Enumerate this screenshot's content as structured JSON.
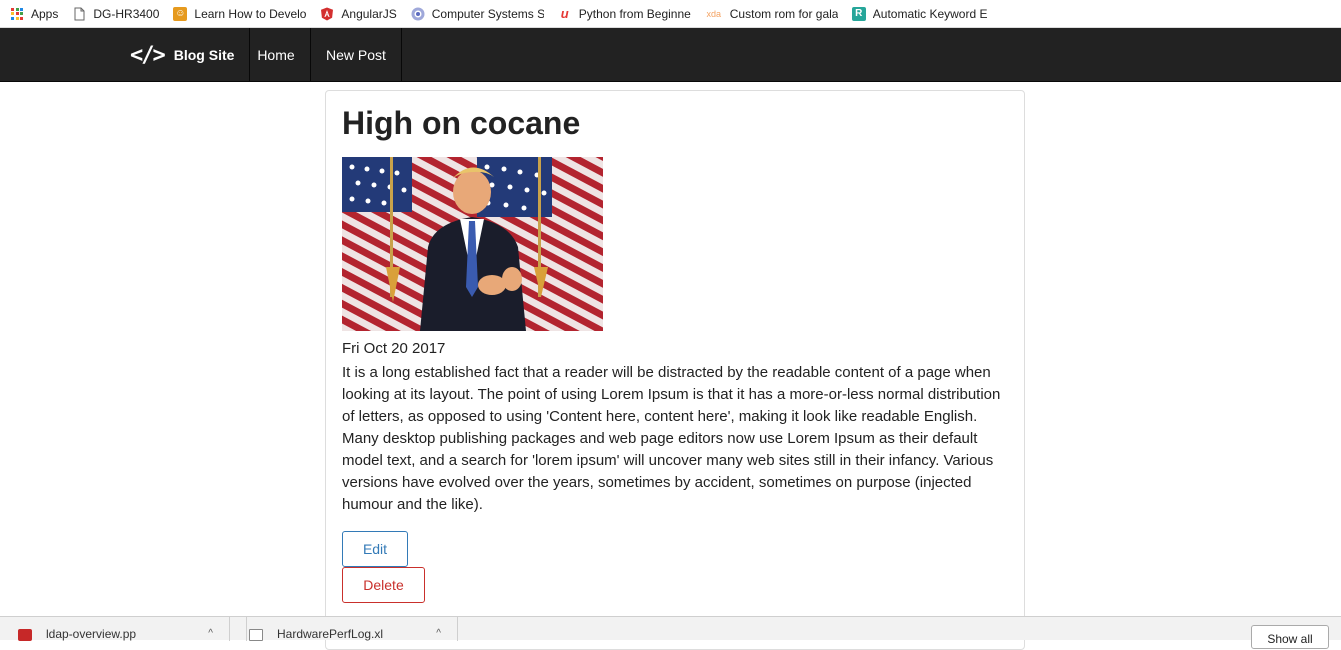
{
  "bookmarks": [
    {
      "label": "Apps",
      "icon": "apps-grid-icon"
    },
    {
      "label": "DG-HR3400",
      "icon": "page-icon"
    },
    {
      "label": "Learn How to Develo",
      "icon": "learn-icon"
    },
    {
      "label": "AngularJS",
      "icon": "angular-icon"
    },
    {
      "label": "Computer Systems Se",
      "icon": "coursera-icon"
    },
    {
      "label": "Python from Beginne",
      "icon": "udemy-icon"
    },
    {
      "label": "Custom rom for gala",
      "icon": "xda-icon"
    },
    {
      "label": "Automatic Keyword E",
      "icon": "rankwatch-icon"
    }
  ],
  "navbar": {
    "brand": "Blog Site",
    "brand_icon": "</>",
    "items": [
      "Home",
      "New Post"
    ]
  },
  "post": {
    "title": "High on cocane",
    "date": "Fri Oct 20 2017",
    "body": "It is a long established fact that a reader will be distracted by the readable content of a page when looking at its layout. The point of using Lorem Ipsum is that it has a more-or-less normal distribution of letters, as opposed to using 'Content here, content here', making it look like readable English. Many desktop publishing packages and web page editors now use Lorem Ipsum as their default model text, and a search for 'lorem ipsum' will uncover many web sites still in their infancy. Various versions have evolved over the years, sometimes by accident, sometimes on purpose (injected humour and the like).",
    "edit_label": "Edit",
    "delete_label": "Delete"
  },
  "downloads": {
    "items": [
      "ldap-overview.pp",
      "HardwarePerfLog.xl"
    ],
    "show_all_label": "Show all"
  },
  "colors": {
    "navbar_bg": "#222222",
    "edit_accent": "#337ab7",
    "delete_accent": "#c9302c"
  }
}
